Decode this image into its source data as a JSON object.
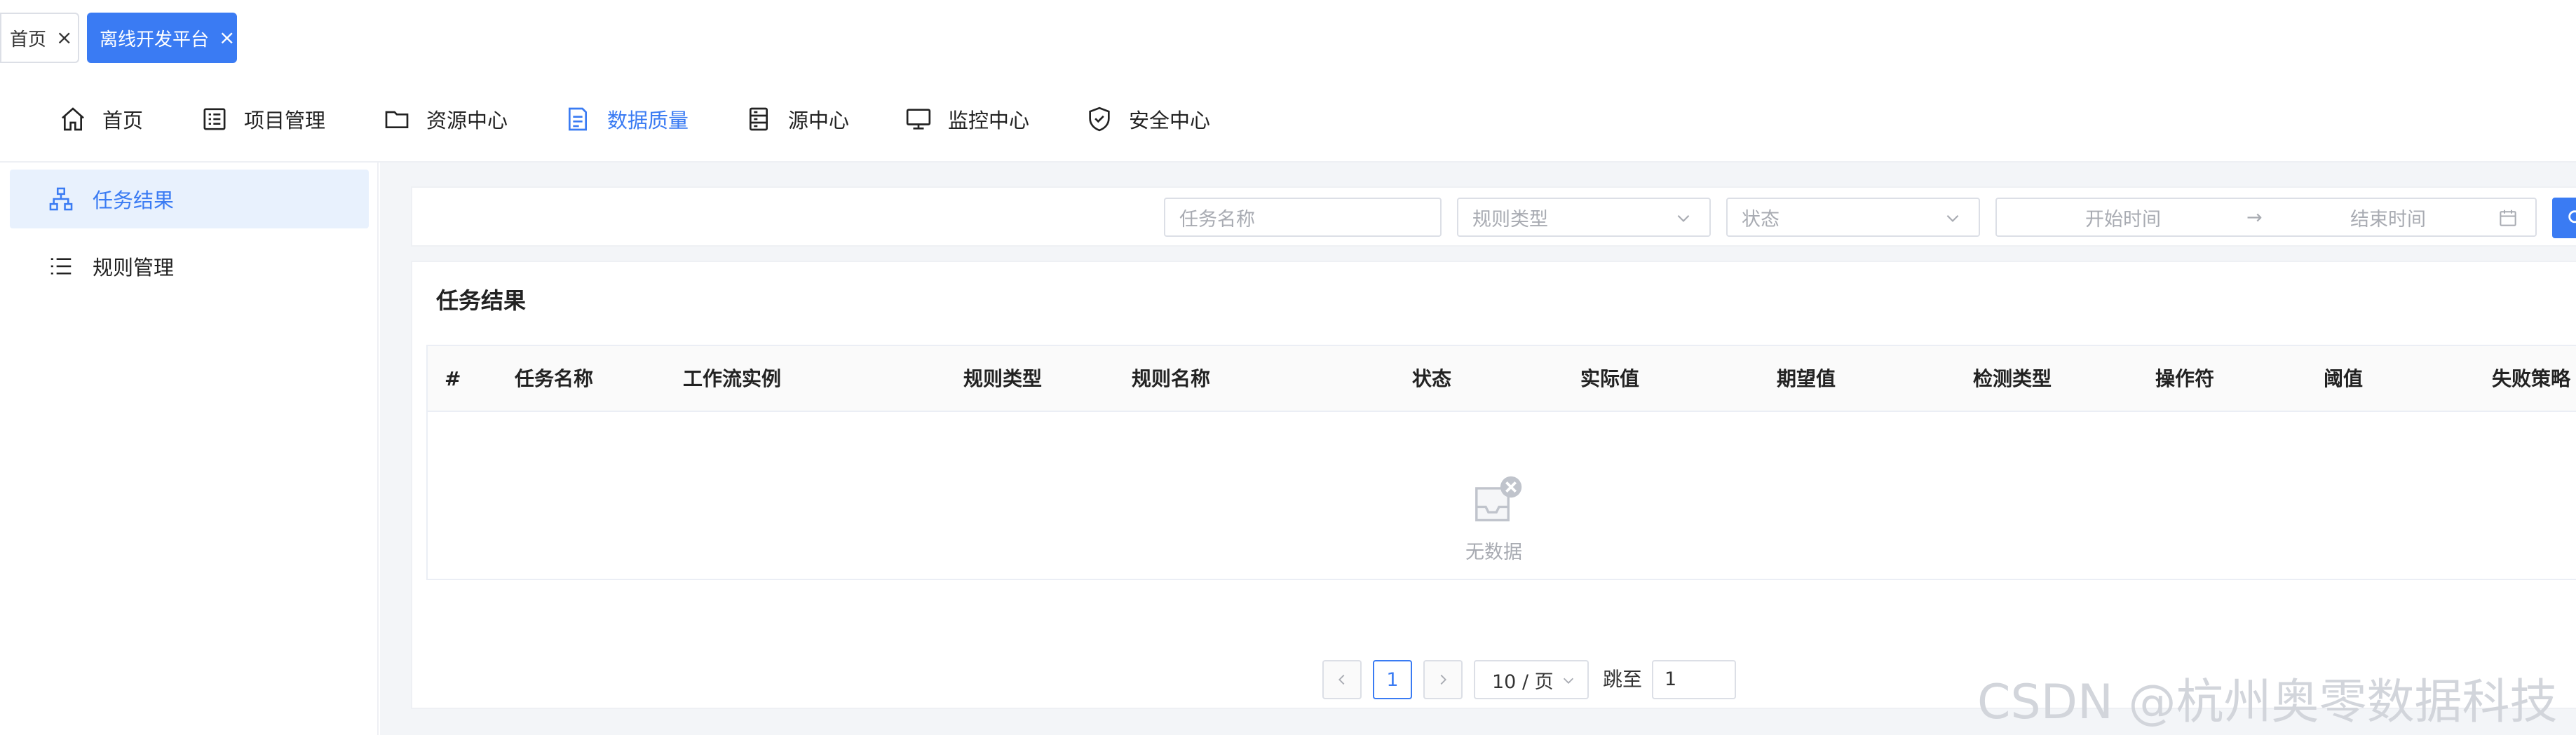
{
  "tabs": {
    "home": {
      "label": "首页",
      "close": "×"
    },
    "offline": {
      "label": "离线开发平台",
      "close": "×"
    }
  },
  "nav": {
    "items": [
      {
        "label": "首页",
        "icon": "home-icon"
      },
      {
        "label": "项目管理",
        "icon": "list-icon"
      },
      {
        "label": "资源中心",
        "icon": "folder-icon"
      },
      {
        "label": "数据质量",
        "icon": "document-icon",
        "active": true
      },
      {
        "label": "源中心",
        "icon": "server-icon"
      },
      {
        "label": "监控中心",
        "icon": "monitor-icon"
      },
      {
        "label": "安全中心",
        "icon": "shield-icon"
      }
    ]
  },
  "sidebar": {
    "items": [
      {
        "label": "任务结果",
        "icon": "sitemap-icon",
        "active": true
      },
      {
        "label": "规则管理",
        "icon": "list-icon"
      }
    ]
  },
  "filters": {
    "task_name_placeholder": "任务名称",
    "rule_type_placeholder": "规则类型",
    "status_placeholder": "状态",
    "start_time_placeholder": "开始时间",
    "date_separator": "→",
    "end_time_placeholder": "结束时间"
  },
  "panel": {
    "title": "任务结果",
    "columns": [
      "#",
      "任务名称",
      "工作流实例",
      "规则类型",
      "规则名称",
      "状态",
      "实际值",
      "期望值",
      "检测类型",
      "操作符",
      "阈值",
      "失败策略"
    ],
    "empty_text": "无数据"
  },
  "pagination": {
    "current_page": "1",
    "page_size": "10 / 页",
    "jump_label": "跳至",
    "jump_value": "1"
  },
  "watermark": "CSDN @杭州奥零数据科技",
  "colors": {
    "accent": "#3a7bf3",
    "active_bg": "#e8f1fd",
    "content_bg": "#f3f5f8",
    "placeholder": "#a8abb2"
  }
}
